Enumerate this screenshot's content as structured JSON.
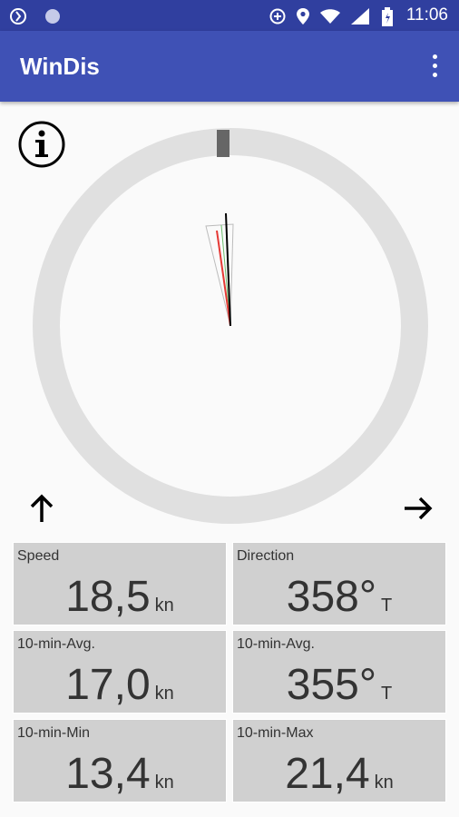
{
  "status_bar": {
    "time": "11:06"
  },
  "app_bar": {
    "title": "WinDis"
  },
  "tiles": [
    {
      "label": "Speed",
      "value": "18,5",
      "unit": "kn"
    },
    {
      "label": "Direction",
      "value": "358°",
      "unit": "T"
    },
    {
      "label": "10-min-Avg.",
      "value": "17,0",
      "unit": "kn"
    },
    {
      "label": "10-min-Avg.",
      "value": "355°",
      "unit": "T"
    },
    {
      "label": "10-min-Min",
      "value": "13,4",
      "unit": "kn"
    },
    {
      "label": "10-min-Max",
      "value": "21,4",
      "unit": "kn"
    }
  ],
  "colors": {
    "app_bar": "#3f51b5",
    "status_bar": "#303f9f",
    "tile_bg": "#d0d0d0",
    "ring": "#e0e0e0",
    "needle_current": "#000000",
    "needle_avg": "#e53935",
    "needle_range": "#a5d6a7"
  },
  "icons": {
    "status_left": [
      "sync-icon",
      "circle-icon"
    ],
    "status_right": [
      "data-saver-icon",
      "location-icon",
      "wifi-icon",
      "signal-icon",
      "battery-icon"
    ],
    "info": "info-icon",
    "menu": "more-vert-icon",
    "left_arrow": "arrow-up-icon",
    "right_arrow": "arrow-right-icon"
  }
}
